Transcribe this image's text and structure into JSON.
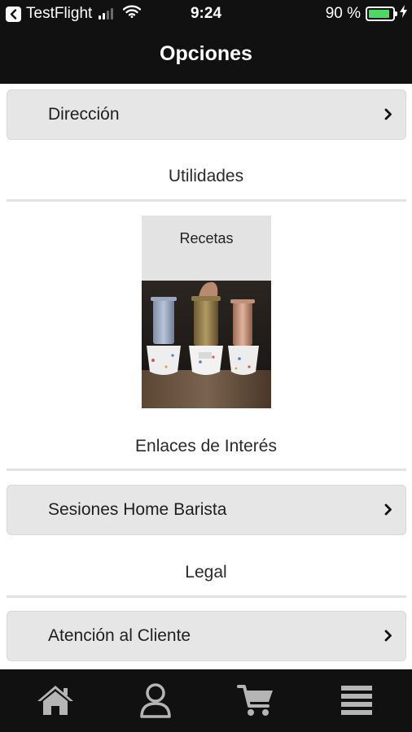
{
  "status_bar": {
    "back_app": "TestFlight",
    "time": "9:24",
    "battery_percent": "90 %",
    "battery_level": 0.9
  },
  "nav": {
    "title": "Opciones"
  },
  "items": {
    "direccion": "Dirección",
    "sesiones": "Sesiones Home Barista",
    "atencion": "Atención al Cliente"
  },
  "sections": {
    "utilidades": "Utilidades",
    "enlaces": "Enlaces de Interés",
    "legal": "Legal"
  },
  "tile": {
    "label": "Recetas"
  },
  "tabbar": {
    "icons": [
      "home-icon",
      "user-icon",
      "cart-icon",
      "menu-icon"
    ]
  },
  "colors": {
    "bar_background": "#111111",
    "row_background": "#e6e6e6",
    "battery_green": "#4cd964",
    "tab_icon": "#b5b5b5"
  }
}
